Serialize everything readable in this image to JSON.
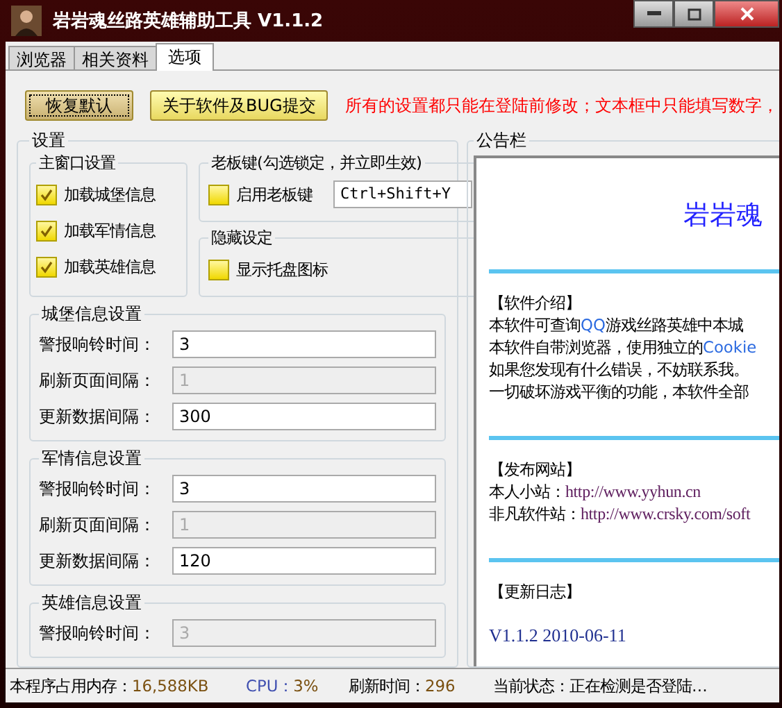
{
  "window": {
    "title": "岩岩魂丝路英雄辅助工具 V1.1.2"
  },
  "tabs": [
    {
      "label": "浏览器",
      "selected": false
    },
    {
      "label": "相关资料",
      "selected": false
    },
    {
      "label": "选项",
      "selected": true
    }
  ],
  "buttons": [
    {
      "label": "恢复默认",
      "focused": true
    },
    {
      "label": "关于软件及BUG提交",
      "focused": false
    }
  ],
  "notice": "所有的设置都只能在登陆前修改；文本框中只能填写数字，",
  "settings": {
    "title": "设置",
    "main_window": {
      "title": "主窗口设置",
      "options": [
        {
          "label": "加载城堡信息",
          "checked": true
        },
        {
          "label": "加载军情信息",
          "checked": true
        },
        {
          "label": "加载英雄信息",
          "checked": true
        }
      ]
    },
    "boss_key": {
      "title": "老板键(勾选锁定，并立即生效)",
      "option": {
        "label": "启用老板键",
        "checked": false
      },
      "hotkey": "Ctrl+Shift+Y"
    },
    "hidden": {
      "title": "隐藏设定",
      "option": {
        "label": "显示托盘图标",
        "checked": false
      }
    },
    "sections": [
      {
        "title": "城堡信息设置",
        "fields": [
          {
            "label": "警报响铃时间：",
            "value": "3",
            "disabled": false
          },
          {
            "label": "刷新页面间隔：",
            "value": "1",
            "disabled": true
          },
          {
            "label": "更新数据间隔：",
            "value": "300",
            "disabled": false
          }
        ]
      },
      {
        "title": "军情信息设置",
        "fields": [
          {
            "label": "警报响铃时间：",
            "value": "3",
            "disabled": false
          },
          {
            "label": "刷新页面间隔：",
            "value": "1",
            "disabled": true
          },
          {
            "label": "更新数据间隔：",
            "value": "120",
            "disabled": false
          }
        ]
      },
      {
        "title": "英雄信息设置",
        "fields": [
          {
            "label": "警报响铃时间：",
            "value": "3",
            "disabled": true
          }
        ]
      }
    ]
  },
  "bulletin": {
    "title": "公告栏",
    "banner": "岩岩魂",
    "sections": [
      {
        "heading": "【软件介绍】",
        "lines": [
          [
            {
              "kind": "plain",
              "text": "本软件可查询"
            },
            {
              "kind": "accent",
              "text": "QQ"
            },
            {
              "kind": "plain",
              "text": "游戏丝路英雄中本城"
            }
          ],
          [
            {
              "kind": "plain",
              "text": "本软件自带浏览器，使用独立的"
            },
            {
              "kind": "accent",
              "text": "Cookie"
            }
          ],
          [
            {
              "kind": "plain",
              "text": "如果您发现有什么错误，不妨联系我。"
            }
          ],
          [
            {
              "kind": "plain",
              "text": "一切破坏游戏平衡的功能，本软件全部"
            }
          ]
        ]
      },
      {
        "heading": "【发布网站】",
        "lines": [
          [
            {
              "kind": "plain",
              "text": "本人小站："
            },
            {
              "kind": "url",
              "text": "http://www.yyhun.cn"
            }
          ],
          [
            {
              "kind": "plain",
              "text": "非凡软件站："
            },
            {
              "kind": "url",
              "text": "http://www.crsky.com/soft"
            }
          ]
        ]
      },
      {
        "heading": "【更新日志】",
        "lines": [
          [
            {
              "kind": "version",
              "text": "V1.1.2 2010-06-11"
            }
          ]
        ]
      }
    ]
  },
  "status_bar": [
    {
      "label": "本程序占用内存：",
      "value": "16,588KB",
      "kind": "plain"
    },
    {
      "label": "CPU：",
      "value": "3%",
      "kind": "accent"
    },
    {
      "label": "刷新时间：",
      "value": "296",
      "kind": "plain"
    },
    {
      "label": "当前状态：正在检测是否登陆…",
      "kind": "plain"
    }
  ]
}
